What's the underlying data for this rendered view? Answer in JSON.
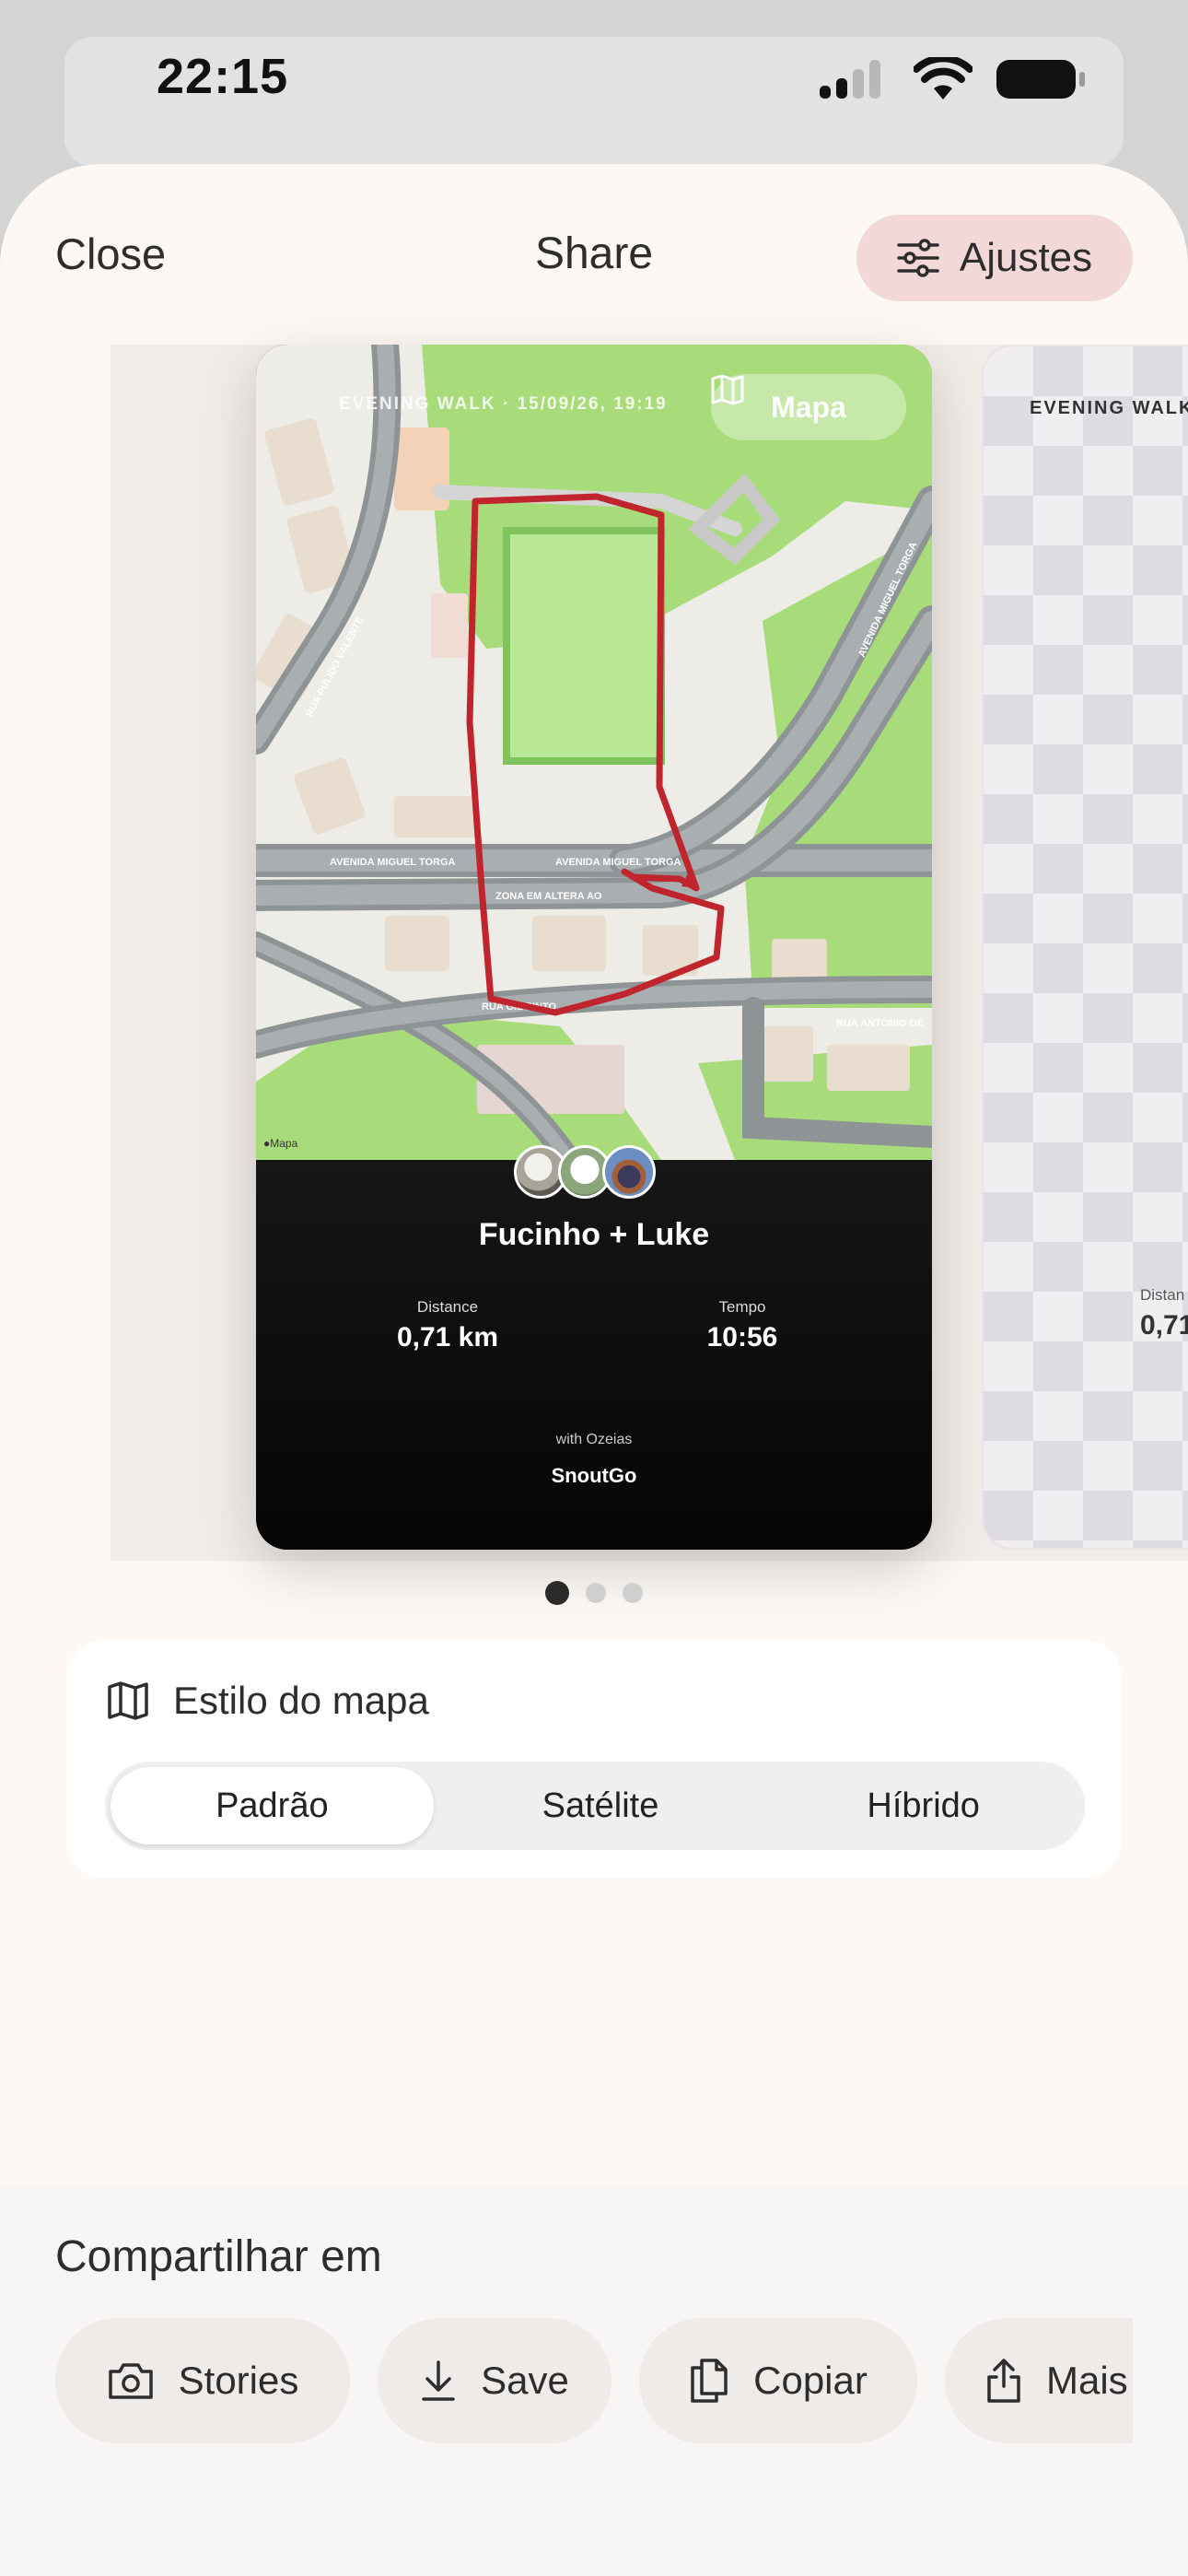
{
  "status_bar": {
    "time": "22:15"
  },
  "nav": {
    "close_label": "Close",
    "title": "Share",
    "adjust_label": "Ajustes"
  },
  "card": {
    "walk_label": "EVENING WALK · 15/09/26, 19:19",
    "map_toggle_label": "Mapa",
    "maps_credit": "Mapa",
    "streets": [
      "RUA PULIDO VALENTE",
      "AVENIDA MIGUEL TORGA",
      "AVENIDA MIGUEL TORGA",
      "ZONA EM ALTERA AO",
      "RUA GIL PINTO",
      "RUA ANTONIO DE",
      "AVENIDA MIGUEL TORGA"
    ],
    "dog_names": "Fucinho + Luke",
    "stats": [
      {
        "label": "Distance",
        "value": "0,71 km"
      },
      {
        "label": "Tempo",
        "value": "10:56"
      }
    ],
    "with_label": "with Ozeias",
    "brand": "SnoutGo"
  },
  "card2": {
    "walk_label": "EVENING WALK ·",
    "stat_label": "Distan",
    "stat_value": "0,71"
  },
  "pager": {
    "count": 3,
    "active": 0
  },
  "map_style": {
    "heading": "Estilo do mapa",
    "options": [
      "Padrão",
      "Satélite",
      "Híbrido"
    ],
    "selected": "Padrão"
  },
  "share": {
    "title": "Compartilhar em",
    "buttons": [
      {
        "label": "Stories",
        "icon": "camera-icon"
      },
      {
        "label": "Save",
        "icon": "download-icon"
      },
      {
        "label": "Copiar",
        "icon": "copy-icon"
      },
      {
        "label": "Mais",
        "icon": "share-icon"
      }
    ]
  },
  "colors": {
    "accent_pill": "#f2d9d8",
    "route": "#c0252d",
    "park": "#a8dc7a",
    "sheet": "#fdf8f4"
  }
}
